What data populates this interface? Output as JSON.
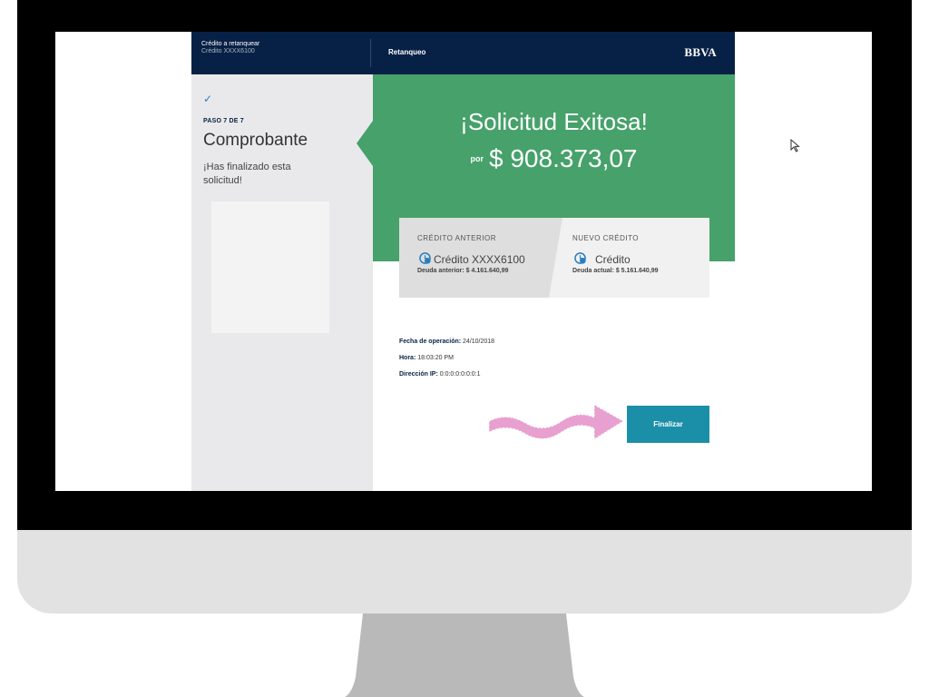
{
  "header": {
    "credit_label": "Crédito a retanquear",
    "credit_number": "Crédito XXXX6100",
    "section_title": "Retanqueo",
    "logo": "BBVA"
  },
  "sidebar": {
    "check_icon": "✓",
    "step": "PASO 7 DE 7",
    "title": "Comprobante",
    "description": "¡Has finalizado esta solicitud!"
  },
  "result": {
    "headline": "¡Solicitud Exitosa!",
    "amount_prefix": "por",
    "amount": "$ 908.373,07"
  },
  "cards": {
    "previous": {
      "title": "CRÉDITO ANTERIOR",
      "name": "Crédito XXXX6100",
      "debt": "Deuda anterior: $ 4.161.640,99",
      "icon": "credit-clock-icon"
    },
    "new": {
      "title": "NUEVO CRÉDITO",
      "name": "Crédito",
      "debt": "Deuda actual: $ 5.161.640,99",
      "icon": "credit-clock-icon"
    }
  },
  "operation": {
    "date_label": "Fecha de operación:",
    "date_value": "24/10/2018",
    "time_label": "Hora:",
    "time_value": "18:03:20 PM",
    "ip_label": "Dirección IP:",
    "ip_value": "0:0:0:0:0:0:0:1"
  },
  "actions": {
    "finalize_label": "Finalizar"
  },
  "colors": {
    "header_bg": "#072146",
    "success_green": "#46a16a",
    "button_teal": "#1c8fa8",
    "arrow_pink": "#e8a0d0"
  }
}
